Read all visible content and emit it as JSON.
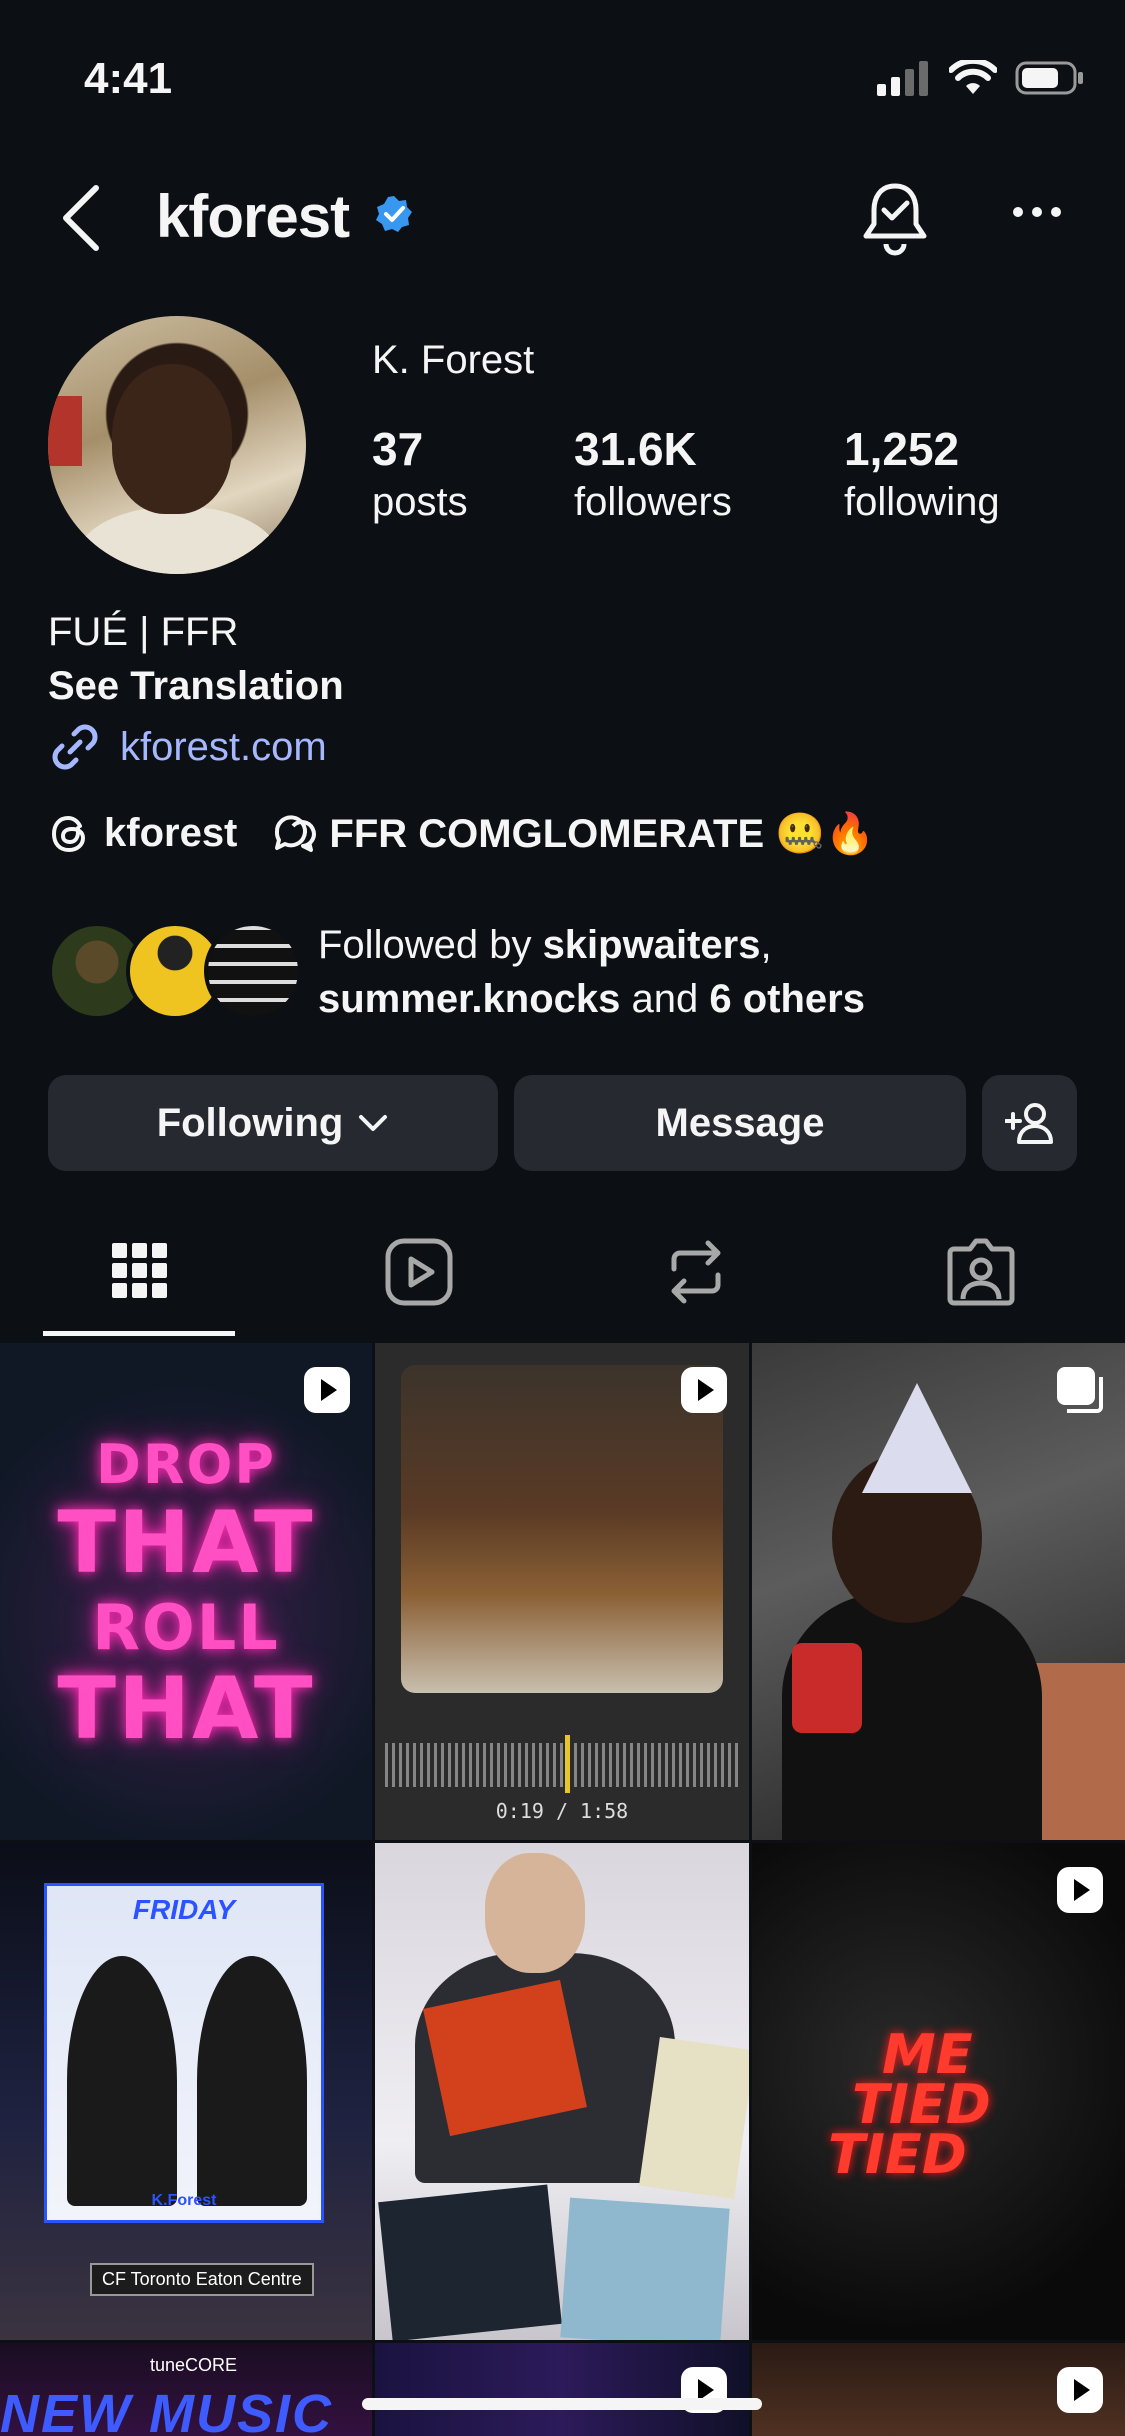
{
  "status_bar": {
    "time": "4:41"
  },
  "header": {
    "username": "kforest"
  },
  "profile": {
    "display_name": "K. Forest",
    "stats": [
      {
        "value": "37",
        "label": "posts"
      },
      {
        "value": "31.6K",
        "label": "followers"
      },
      {
        "value": "1,252",
        "label": "following"
      }
    ],
    "bio": "FUÉ | FFR",
    "see_translation": "See Translation",
    "link": "kforest.com",
    "threads_handle": "kforest",
    "channel_name": "FFR COMGLOMERATE 🤐🔥",
    "followed_by": {
      "prefix": "Followed by ",
      "user1": "skipwaiters",
      "comma": ",",
      "user2": "summer.knocks",
      "and": " and ",
      "others": "6 others"
    }
  },
  "actions": {
    "following": "Following",
    "message": "Message"
  },
  "grid": {
    "post1_lines": [
      "DROP",
      "THAT",
      "ROLL",
      "THAT"
    ],
    "post2_timer": "0:19 / 1:58",
    "post4_billboard": "FRIDAY",
    "post4_name": "K.Forest",
    "post4_sign": "CF Toronto Eaton Centre",
    "post6_lines": [
      "ME",
      "TIED",
      "TIED"
    ],
    "post7_brand": "tuneCORE",
    "post7_text": "NEW MUSIC"
  }
}
